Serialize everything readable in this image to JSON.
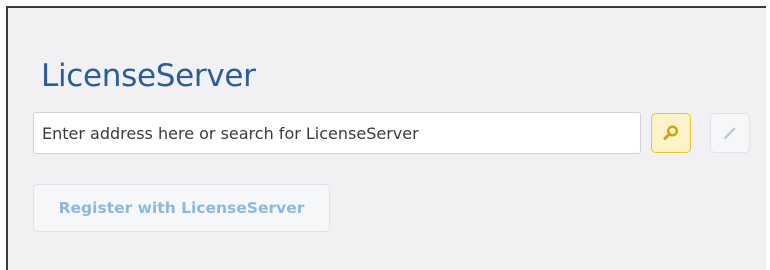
{
  "title": "LicenseServer",
  "search": {
    "placeholder": "Enter address here or search for LicenseServer",
    "value": ""
  },
  "buttons": {
    "search_icon": "search-icon",
    "edit_icon": "pencil-icon",
    "register_label": "Register with LicenseServer"
  },
  "colors": {
    "title": "#2c5d97",
    "panel_background": "#f1f1f3",
    "search_button_fill": "#fdf3c8",
    "search_button_border": "#f3c233",
    "search_icon": "#d4a00b",
    "disabled_text": "#8fb8dd",
    "edit_icon": "#b9cbdc"
  }
}
